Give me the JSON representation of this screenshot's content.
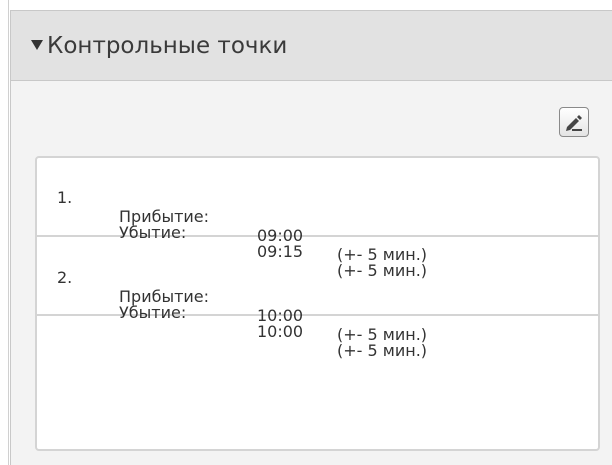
{
  "panel": {
    "title": "Контрольные точки",
    "icons": {
      "collapse": "triangle-down-icon",
      "edit": "pencil-edit-icon"
    }
  },
  "checkpoints": [
    {
      "number": "1.",
      "arrival_label": "Прибытие:",
      "arrival_time": "09:00",
      "arrival_tolerance": "(+- 5 мин.)",
      "departure_label": "Убытие:",
      "departure_time": "09:15",
      "departure_tolerance": "(+- 5 мин.)"
    },
    {
      "number": "2.",
      "arrival_label": "Прибытие:",
      "arrival_time": "10:00",
      "arrival_tolerance": "(+- 5 мин.)",
      "departure_label": "Убытие:",
      "departure_time": "10:00",
      "departure_tolerance": "(+- 5 мин.)"
    }
  ]
}
